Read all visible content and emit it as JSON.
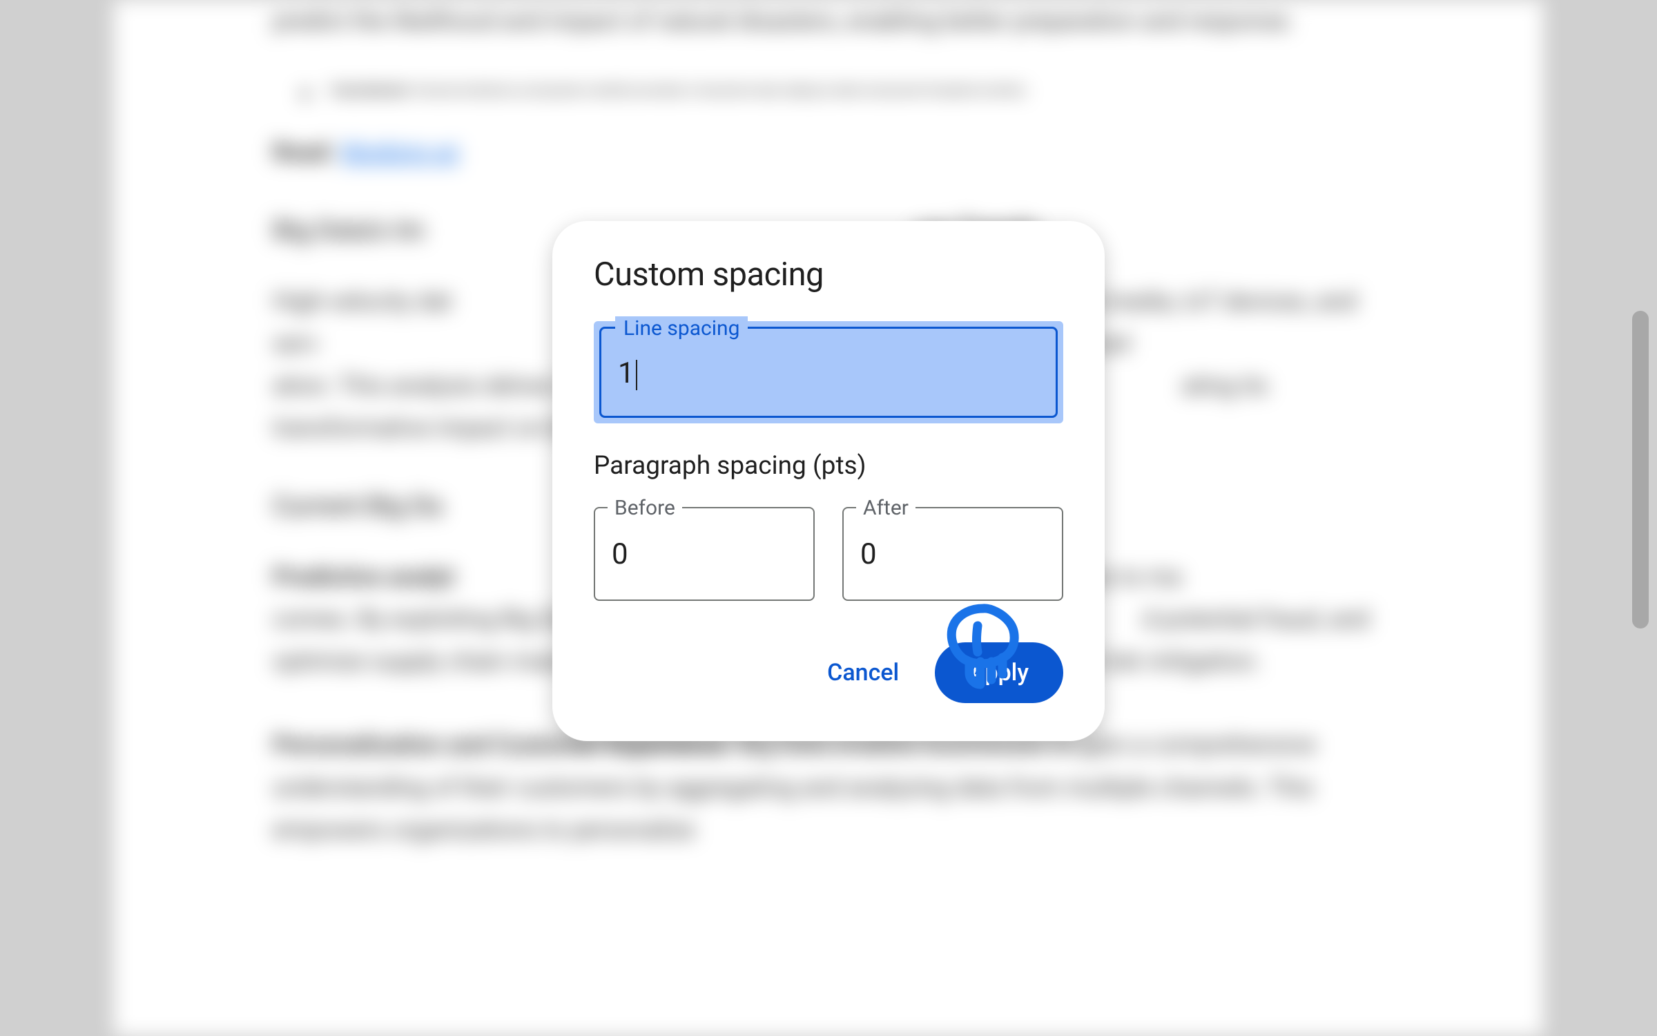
{
  "background_doc": {
    "para1": "predict the likelihood and impact of natural disasters, enabling better preparation and response.",
    "bullet_bold": "Fraud detection",
    "bullet_text": ": Financial institutions use big data to identify anomalies in transaction data, helping to detect and prevent fraudulent activities.",
    "read_label": "Read:",
    "read_link": "Working wi",
    "heading1": "Big Data's Im",
    "heading1_suffix": "ure Trends",
    "para2": "High-velocity dat                                                                                         h as social media, IoT devices, and serv                                                                                  ptimize their operations, devel                                                                                      ation. This analysis delves into the cu                                                                                     ating its transformative impact on busines",
    "heading2": "Current Big Da",
    "bold2": "Predictive analyt",
    "para3": "                                                                and statistical techniques to ma                                                                           comes. By exploiting Big Data, business                                                                          d potential fraud, and optimize supply chain management, fostering proactive decision-making and risk mitigation.",
    "bold3": "Personalization and Customer Experience",
    "para4": ". Big Data enables businesses to gain a comprehensive understanding of their customers by aggregating and analyzing data from multiple channels. This empowers organizations to personalize"
  },
  "dialog": {
    "title": "Custom spacing",
    "line_spacing": {
      "label": "Line spacing",
      "value": "1"
    },
    "paragraph_section_label": "Paragraph spacing (pts)",
    "before": {
      "label": "Before",
      "value": "0"
    },
    "after": {
      "label": "After",
      "value": "0"
    },
    "cancel_label": "Cancel",
    "apply_label": "Apply"
  }
}
